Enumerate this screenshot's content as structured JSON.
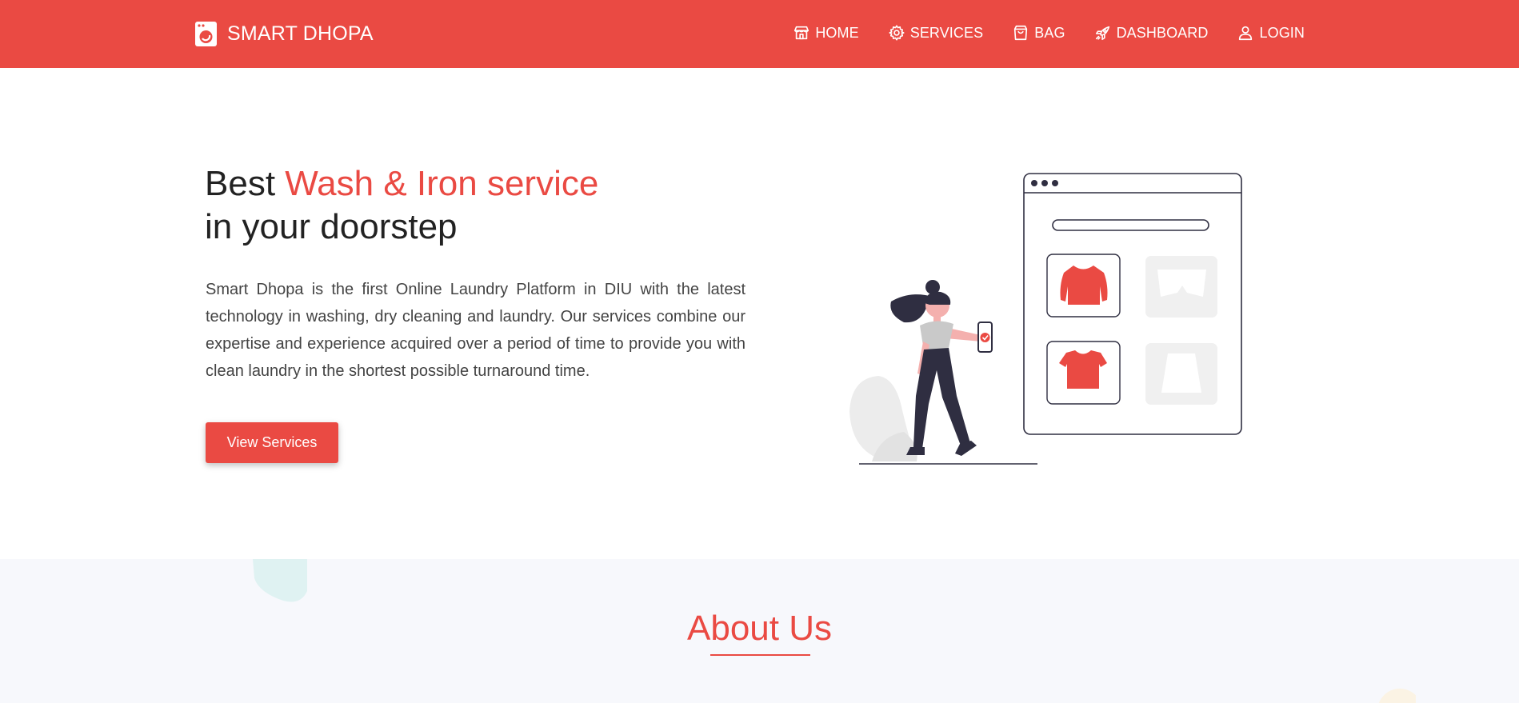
{
  "brand": {
    "name": "SMART DHOPA",
    "icon": "washing-machine-icon"
  },
  "nav": {
    "items": [
      {
        "label": "HOME",
        "icon": "store-icon"
      },
      {
        "label": "SERVICES",
        "icon": "gear-icon"
      },
      {
        "label": "BAG",
        "icon": "shopping-bag-icon"
      },
      {
        "label": "DASHBOARD",
        "icon": "rocket-icon"
      },
      {
        "label": "LOGIN",
        "icon": "user-icon"
      }
    ]
  },
  "hero": {
    "title_prefix": "Best ",
    "title_accent": "Wash & Iron service",
    "title_line2": "in your doorstep",
    "description": "Smart Dhopa is the first Online Laundry Platform in DIU with the latest technology in washing, dry cleaning and laundry. Our services combine our expertise and experience acquired over a period of time to provide you with clean laundry in the shortest possible turnaround time.",
    "button_label": "View Services"
  },
  "about": {
    "title": "About Us"
  },
  "colors": {
    "primary": "#ea4a43",
    "dark": "#2f2e41",
    "muted_bg": "#f7f8fc"
  }
}
